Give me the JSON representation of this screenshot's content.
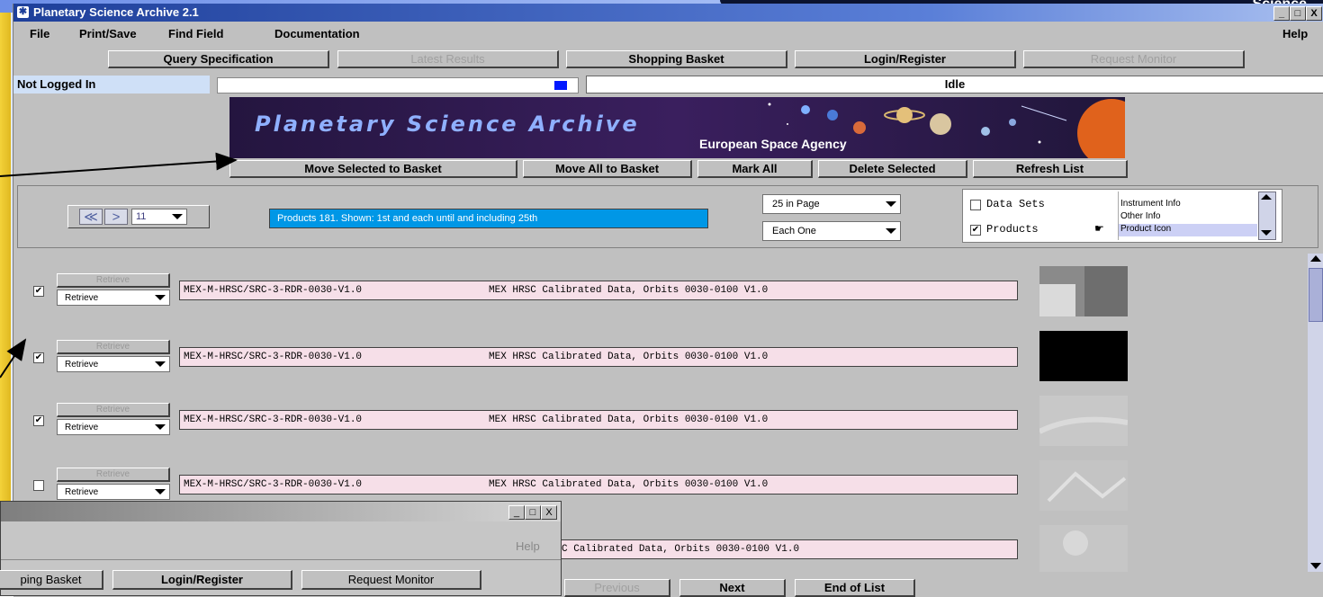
{
  "window": {
    "title": "Planetary Science Archive 2.1",
    "controls": [
      "_",
      "□",
      "X"
    ]
  },
  "slide": {
    "corner_text": "Science"
  },
  "menu": {
    "file": "File",
    "print_save": "Print/Save",
    "find_field": "Find Field",
    "documentation": "Documentation",
    "help": "Help"
  },
  "tabs": {
    "query": "Query Specification",
    "latest": "Latest Results",
    "basket": "Shopping Basket",
    "login": "Login/Register",
    "monitor": "Request Monitor"
  },
  "status": {
    "login": "Not Logged In",
    "state": "Idle",
    "progress": 0.96
  },
  "banner": {
    "title": "Planetary Science Archive",
    "subtitle": "European Space Agency"
  },
  "actions": {
    "move_selected": "Move Selected to Basket",
    "move_all": "Move All to Basket",
    "mark_all": "Mark All",
    "delete_selected": "Delete Selected",
    "refresh": "Refresh List"
  },
  "pager": {
    "page_value": "11",
    "info": "Products 181. Shown: 1st  and each until and including  25th"
  },
  "page_size": {
    "selected": "25 in Page"
  },
  "step": {
    "selected": "Each One"
  },
  "filters": {
    "datasets": "Data Sets",
    "products": "Products"
  },
  "columns_list": {
    "items": [
      "Instrument Info",
      "Other Info",
      "Product Icon"
    ],
    "selected": "Product Icon"
  },
  "rows": [
    {
      "checked": "✔",
      "retrieve_btn": "Retrieve",
      "retrieve_opt": "Retrieve",
      "id": "MEX-M-HRSC/SRC-3-RDR-0030-V1.0",
      "desc": "MEX HRSC Calibrated Data, Orbits 0030-0100 V1.0"
    },
    {
      "checked": "✔",
      "retrieve_btn": "Retrieve",
      "retrieve_opt": "Retrieve",
      "id": "MEX-M-HRSC/SRC-3-RDR-0030-V1.0",
      "desc": "MEX HRSC Calibrated Data, Orbits 0030-0100 V1.0"
    },
    {
      "checked": "✔",
      "retrieve_btn": "Retrieve",
      "retrieve_opt": "Retrieve",
      "id": "MEX-M-HRSC/SRC-3-RDR-0030-V1.0",
      "desc": "MEX HRSC Calibrated Data, Orbits 0030-0100 V1.0"
    },
    {
      "checked": "",
      "retrieve_btn": "Retrieve",
      "retrieve_opt": "Retrieve",
      "id": "MEX-M-HRSC/SRC-3-RDR-0030-V1.0",
      "desc": "MEX HRSC Calibrated Data, Orbits 0030-0100 V1.0"
    },
    {
      "partial": "C Calibrated Data, Orbits 0030-0100 V1.0"
    }
  ],
  "bottom": {
    "previous": "Previous",
    "next": "Next",
    "end": "End of List"
  },
  "dialog": {
    "help": "Help",
    "basket": "ping Basket",
    "login": "Login/Register",
    "monitor": "Request Monitor"
  }
}
